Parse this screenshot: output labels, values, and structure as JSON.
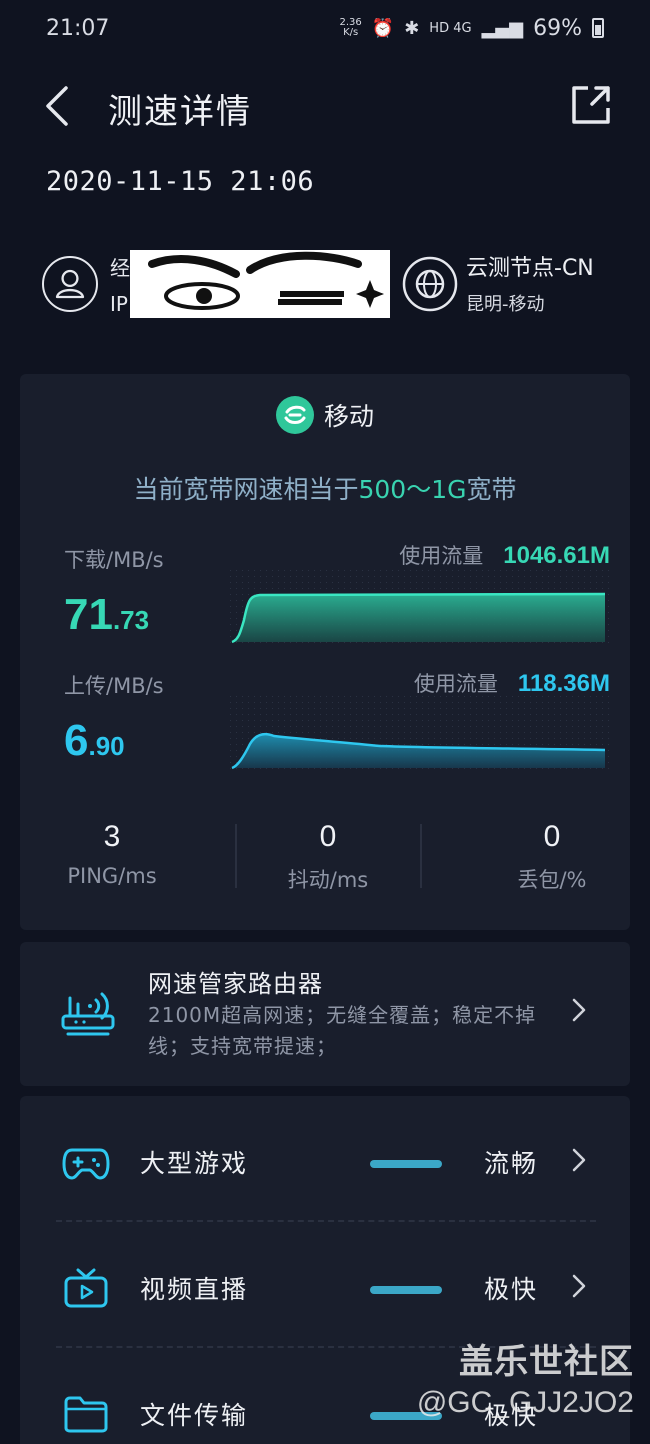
{
  "status_bar": {
    "time": "21:07",
    "net_speed": "2.36",
    "net_unit": "K/s",
    "network": "HD 4G",
    "battery": "69%"
  },
  "nav": {
    "title": "测速详情"
  },
  "test": {
    "datetime": "2020-11-15 21:06"
  },
  "user": {
    "line1_prefix": "经",
    "line2_prefix": "IP"
  },
  "node": {
    "name": "云测节点-CN",
    "location": "昆明-移动"
  },
  "result": {
    "isp": "移动",
    "compare_prefix": "当前宽带网速相当于",
    "compare_value": "500～1G",
    "compare_suffix": "宽带",
    "download": {
      "label": "下载/MB/s",
      "int": "71",
      "dec": ".73",
      "usage_label": "使用流量",
      "usage": "1046.61M",
      "color": "#37d8b5"
    },
    "upload": {
      "label": "上传/MB/s",
      "int": "6",
      "dec": ".90",
      "usage_label": "使用流量",
      "usage": "118.36M",
      "color": "#2ec7ef"
    },
    "ping": {
      "value": "3",
      "label": "PING/ms"
    },
    "jitter": {
      "value": "0",
      "label": "抖动/ms"
    },
    "loss": {
      "value": "0",
      "label": "丢包/%"
    }
  },
  "router_ad": {
    "title": "网速管家路由器",
    "desc": "2100M超高网速；无缝全覆盖；稳定不掉线；支持宽带提速；"
  },
  "apps": [
    {
      "name": "大型游戏",
      "status": "流畅",
      "icon": "gamepad-icon"
    },
    {
      "name": "视频直播",
      "status": "极快",
      "icon": "tv-icon"
    },
    {
      "name": "文件传输",
      "status": "极快",
      "icon": "folder-icon"
    }
  ],
  "watermark": {
    "line1": "盖乐世社区",
    "line2": "@GC_GJJ2JO2"
  },
  "colors": {
    "background": "#0f1320",
    "card": "#191e2c",
    "accent_green": "#37d8b5",
    "accent_blue": "#2ec7ef"
  }
}
